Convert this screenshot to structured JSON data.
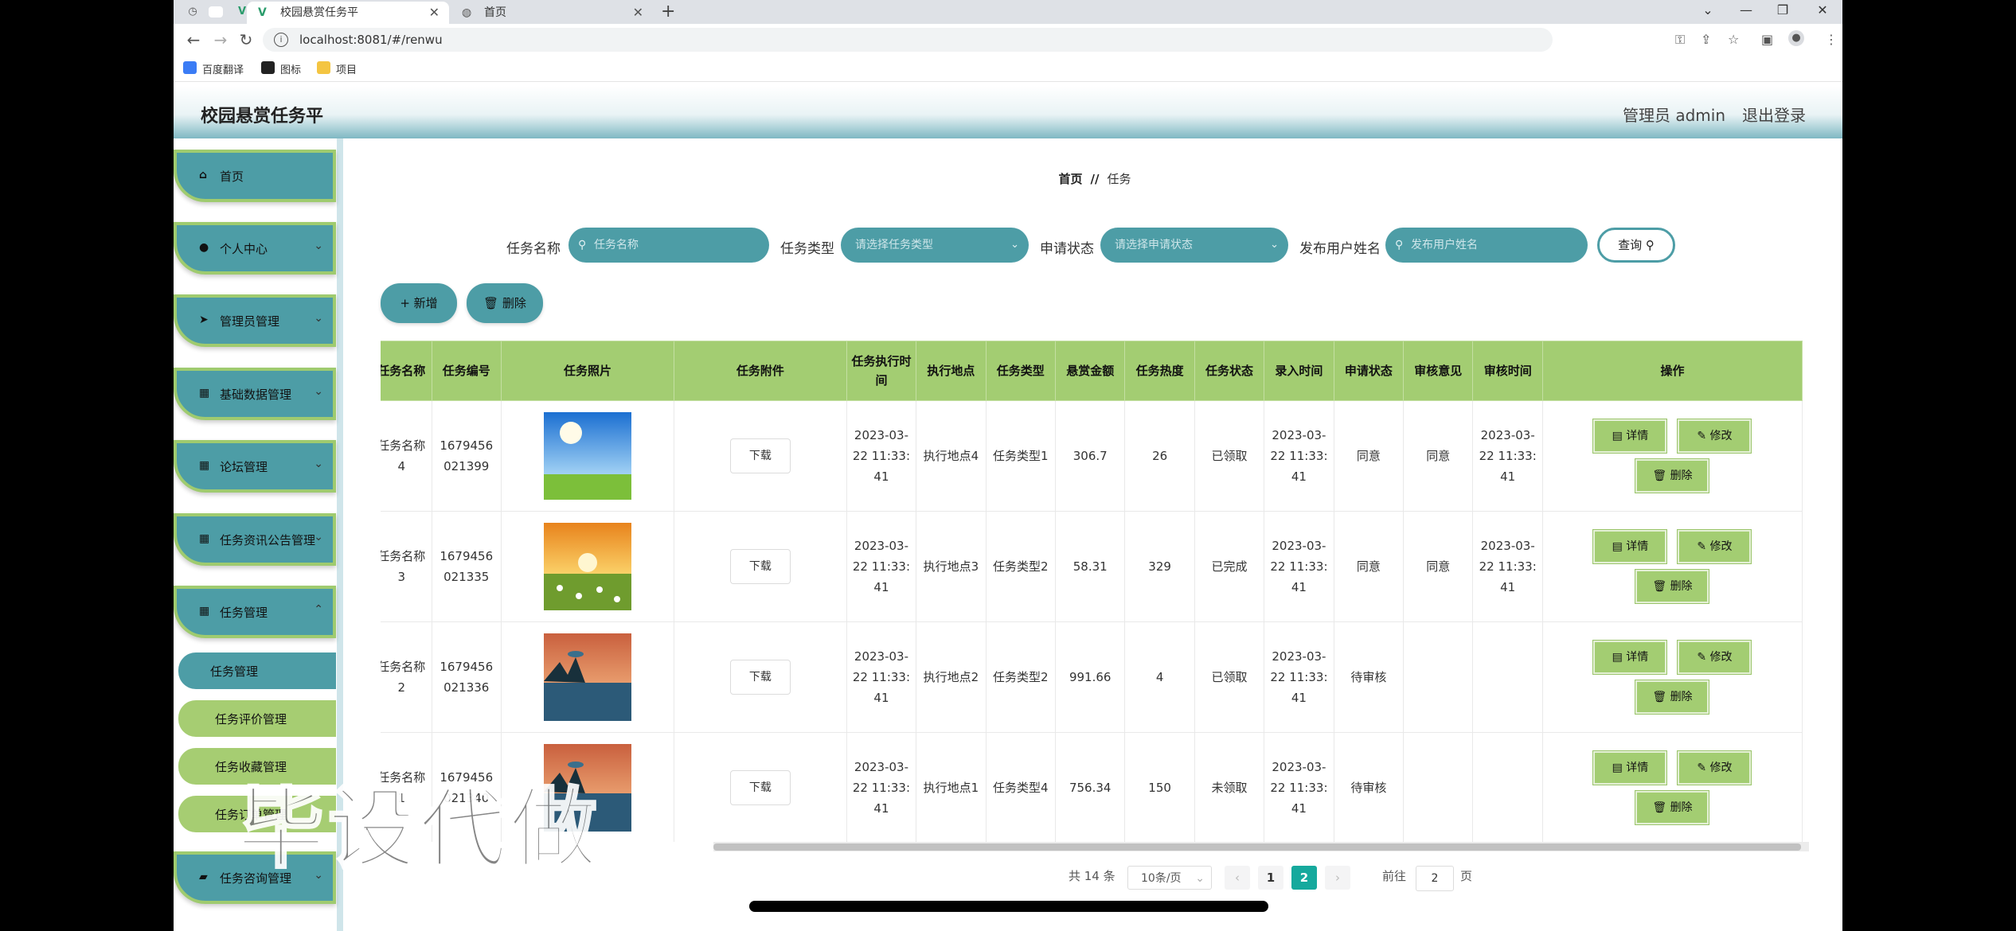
{
  "browser": {
    "tabs": [
      {
        "title": "校园悬赏任务平",
        "active": true
      },
      {
        "title": "首页",
        "active": false
      }
    ],
    "url": "localhost:8081/#/renwu",
    "bookmarks": [
      "百度翻译",
      "图标",
      "项目"
    ]
  },
  "header": {
    "title": "校园悬赏任务平",
    "admin": "管理员 admin",
    "logout": "退出登录"
  },
  "sidebar": {
    "menus": [
      "首页",
      "个人中心",
      "管理员管理",
      "基础数据管理",
      "论坛管理",
      "任务资讯公告管理",
      "任务管理",
      "任务咨询管理"
    ],
    "submenus": [
      "任务管理",
      "任务评价管理",
      "任务收藏管理",
      "任务订单管理"
    ]
  },
  "breadcrumb": {
    "home": "首页",
    "sep": "//",
    "current": "任务"
  },
  "search": {
    "name_label": "任务名称",
    "name_placeholder": "任务名称",
    "type_label": "任务类型",
    "type_placeholder": "请选择任务类型",
    "status_label": "申请状态",
    "status_placeholder": "请选择申请状态",
    "user_label": "发布用户姓名",
    "user_placeholder": "发布用户姓名",
    "query": "查询"
  },
  "actions": {
    "add": "新增",
    "delete": "删除"
  },
  "table": {
    "columns": [
      "任务名称",
      "任务编号",
      "任务照片",
      "任务附件",
      "任务执行时间",
      "执行地点",
      "任务类型",
      "悬赏金额",
      "任务热度",
      "任务状态",
      "录入时间",
      "申请状态",
      "审核意见",
      "审核时间",
      "操作"
    ],
    "rows": [
      {
        "name": "任务名称4",
        "code": "1679456021399",
        "attach": "下载",
        "time": "2023-03-22 11:33:41",
        "place": "执行地点4",
        "type": "任务类型1",
        "money": "306.7",
        "heat": "26",
        "state": "已领取",
        "entry": "2023-03-22 11:33:41",
        "apply": "同意",
        "opinion": "同意",
        "audit": "2023-03-22 11:33:41"
      },
      {
        "name": "任务名称3",
        "code": "1679456021335",
        "attach": "下载",
        "time": "2023-03-22 11:33:41",
        "place": "执行地点3",
        "type": "任务类型2",
        "money": "58.31",
        "heat": "329",
        "state": "已完成",
        "entry": "2023-03-22 11:33:41",
        "apply": "同意",
        "opinion": "同意",
        "audit": "2023-03-22 11:33:41"
      },
      {
        "name": "任务名称2",
        "code": "1679456021336",
        "attach": "下载",
        "time": "2023-03-22 11:33:41",
        "place": "执行地点2",
        "type": "任务类型2",
        "money": "991.66",
        "heat": "4",
        "state": "已领取",
        "entry": "2023-03-22 11:33:41",
        "apply": "待审核",
        "opinion": "",
        "audit": ""
      },
      {
        "name": "任务名称1",
        "code": "1679456021340",
        "attach": "下载",
        "time": "2023-03-22 11:33:41",
        "place": "执行地点1",
        "type": "任务类型4",
        "money": "756.34",
        "heat": "150",
        "state": "未领取",
        "entry": "2023-03-22 11:33:41",
        "apply": "待审核",
        "opinion": "",
        "audit": ""
      }
    ],
    "ops": {
      "detail": "详情",
      "edit": "修改",
      "delete": "删除"
    }
  },
  "pagination": {
    "total": "共 14 条",
    "size": "10条/页",
    "pages": [
      "1",
      "2"
    ],
    "current": "2",
    "goto_label": "前往",
    "goto_value": "2",
    "page_suffix": "页"
  },
  "watermark": "毕设代做"
}
